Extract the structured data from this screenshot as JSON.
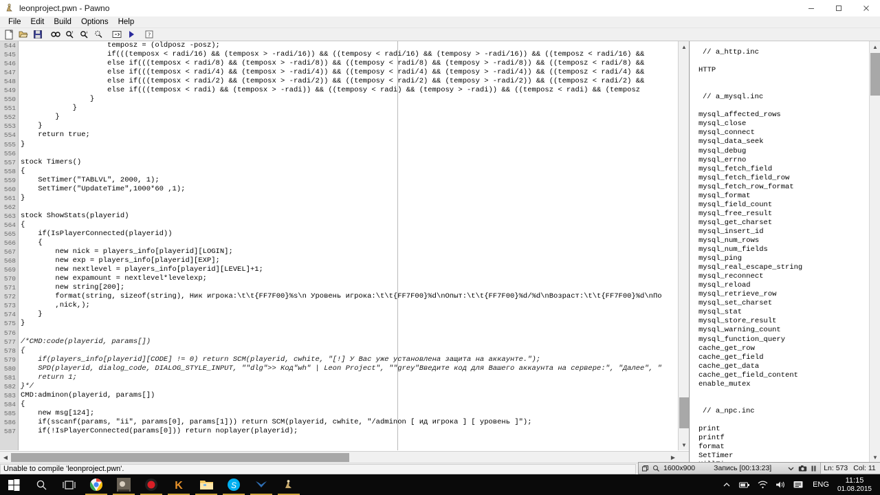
{
  "window": {
    "title": "leonproject.pwn - Pawno",
    "icon": "pawno-icon",
    "minimize": "minimize-icon",
    "maximize": "maximize-icon",
    "close": "close-icon"
  },
  "menubar": {
    "items": [
      "File",
      "Edit",
      "Build",
      "Options",
      "Help"
    ]
  },
  "toolbar": {
    "buttons": [
      {
        "name": "new-file-icon",
        "tip": "New"
      },
      {
        "name": "open-file-icon",
        "tip": "Open"
      },
      {
        "name": "save-file-icon",
        "tip": "Save"
      },
      {
        "name": "find-icon",
        "tip": "Find"
      },
      {
        "name": "find-previous-icon",
        "tip": "Find previous"
      },
      {
        "name": "find-next-icon",
        "tip": "Find next"
      },
      {
        "name": "replace-icon",
        "tip": "Replace"
      },
      {
        "name": "compile-icon",
        "tip": "Compile"
      },
      {
        "name": "run-icon",
        "tip": "Run"
      },
      {
        "name": "help-icon",
        "tip": "Help"
      }
    ]
  },
  "editor": {
    "first_line": 544,
    "lines": [
      {
        "n": 544,
        "text": "                    temposz = (oldposz -posz);",
        "italic": false
      },
      {
        "n": 545,
        "text": "                    if(((temposx < radi/16) && (temposx > -radi/16)) && ((temposy < radi/16) && (temposy > -radi/16)) && ((temposz < radi/16) &&",
        "italic": false
      },
      {
        "n": 546,
        "text": "                    else if(((temposx < radi/8) && (temposx > -radi/8)) && ((temposy < radi/8) && (temposy > -radi/8)) && ((temposz < radi/8) &&",
        "italic": false
      },
      {
        "n": 547,
        "text": "                    else if(((temposx < radi/4) && (temposx > -radi/4)) && ((temposy < radi/4) && (temposy > -radi/4)) && ((temposz < radi/4) &&",
        "italic": false
      },
      {
        "n": 548,
        "text": "                    else if(((temposx < radi/2) && (temposx > -radi/2)) && ((temposy < radi/2) && (temposy > -radi/2)) && ((temposz < radi/2) &&",
        "italic": false
      },
      {
        "n": 549,
        "text": "                    else if(((temposx < radi) && (temposx > -radi)) && ((temposy < radi) && (temposy > -radi)) && ((temposz < radi) && (temposz",
        "italic": false
      },
      {
        "n": 550,
        "text": "                }",
        "italic": false
      },
      {
        "n": 551,
        "text": "            }",
        "italic": false
      },
      {
        "n": 552,
        "text": "        }",
        "italic": false
      },
      {
        "n": 553,
        "text": "    }",
        "italic": false
      },
      {
        "n": 554,
        "text": "    return true;",
        "italic": false
      },
      {
        "n": 555,
        "text": "}",
        "italic": false
      },
      {
        "n": 556,
        "text": "",
        "italic": false
      },
      {
        "n": 557,
        "text": "stock Timers()",
        "italic": false
      },
      {
        "n": 558,
        "text": "{",
        "italic": false
      },
      {
        "n": 559,
        "text": "    SetTimer(\"TABLVL\", 2000, 1);",
        "italic": false
      },
      {
        "n": 560,
        "text": "    SetTimer(\"UpdateTime\",1000*60 ,1);",
        "italic": false
      },
      {
        "n": 561,
        "text": "}",
        "italic": false
      },
      {
        "n": 562,
        "text": "",
        "italic": false
      },
      {
        "n": 563,
        "text": "stock ShowStats(playerid)",
        "italic": false
      },
      {
        "n": 564,
        "text": "{",
        "italic": false
      },
      {
        "n": 565,
        "text": "    if(IsPlayerConnected(playerid))",
        "italic": false
      },
      {
        "n": 566,
        "text": "    {",
        "italic": false
      },
      {
        "n": 567,
        "text": "        new nick = players_info[playerid][LOGIN];",
        "italic": false
      },
      {
        "n": 568,
        "text": "        new exp = players_info[playerid][EXP];",
        "italic": false
      },
      {
        "n": 569,
        "text": "        new nextlevel = players_info[playerid][LEVEL]+1;",
        "italic": false
      },
      {
        "n": 570,
        "text": "        new expamount = nextlevel*levelexp;",
        "italic": false
      },
      {
        "n": 571,
        "text": "        new string[200];",
        "italic": false
      },
      {
        "n": 572,
        "text": "        format(string, sizeof(string), Ник игрока:\\t\\t{FF7F00}%s\\n Уровень игрока:\\t\\t{FF7F00}%d\\nОпыт:\\t\\t{FF7F00}%d/%d\\nВозраст:\\t\\t{FF7F00}%d\\nПо",
        "italic": false
      },
      {
        "n": 573,
        "text": "        ,nick,);",
        "italic": false
      },
      {
        "n": 574,
        "text": "    }",
        "italic": false
      },
      {
        "n": 575,
        "text": "}",
        "italic": false
      },
      {
        "n": 576,
        "text": "",
        "italic": false
      },
      {
        "n": 577,
        "text": "/*CMD:code(playerid, params[])",
        "italic": true
      },
      {
        "n": 578,
        "text": "{",
        "italic": true
      },
      {
        "n": 579,
        "text": "    if(players_info[playerid][CODE] != 0) return SCM(playerid, cwhite, \"[!] У Вас уже установлена защита на аккаунте.\");",
        "italic": true
      },
      {
        "n": 580,
        "text": "    SPD(playerid, dialog_code, DIALOG_STYLE_INPUT, \"\"dlg\">> Код\"wh\" | Leon Project\", \"\"grey\"Введите код для Вашего аккаунта на сервере:\", \"Далее\", \"",
        "italic": true
      },
      {
        "n": 581,
        "text": "    return 1;",
        "italic": true
      },
      {
        "n": 582,
        "text": "}*/",
        "italic": true
      },
      {
        "n": 583,
        "text": "CMD:adminon(playerid, params[])",
        "italic": false
      },
      {
        "n": 584,
        "text": "{",
        "italic": false
      },
      {
        "n": 585,
        "text": "    new msg[124];",
        "italic": false
      },
      {
        "n": 586,
        "text": "    if(sscanf(params, \"ii\", params[0], params[1])) return SCM(playerid, cwhite, \"/adminon [ ид игрока ] [ уровень ]\");",
        "italic": false
      },
      {
        "n": 587,
        "text": "    if(!IsPlayerConnected(params[0])) return noplayer(playerid);",
        "italic": false
      }
    ],
    "scroll_up_icon": "scroll-up-arrow-icon",
    "scroll_down_icon": "scroll-down-arrow-icon",
    "scroll_left_icon": "scroll-left-arrow-icon",
    "scroll_right_icon": "scroll-right-arrow-icon"
  },
  "function_panel": {
    "items": [
      {
        "text": "// a_http.inc",
        "kind": "header"
      },
      {
        "text": "",
        "kind": "blank"
      },
      {
        "text": "HTTP",
        "kind": "fn"
      },
      {
        "text": "",
        "kind": "blank"
      },
      {
        "text": "",
        "kind": "blank"
      },
      {
        "text": "// a_mysql.inc",
        "kind": "header"
      },
      {
        "text": "",
        "kind": "blank"
      },
      {
        "text": "mysql_affected_rows",
        "kind": "fn"
      },
      {
        "text": "mysql_close",
        "kind": "fn"
      },
      {
        "text": "mysql_connect",
        "kind": "fn"
      },
      {
        "text": "mysql_data_seek",
        "kind": "fn"
      },
      {
        "text": "mysql_debug",
        "kind": "fn"
      },
      {
        "text": "mysql_errno",
        "kind": "fn"
      },
      {
        "text": "mysql_fetch_field",
        "kind": "fn"
      },
      {
        "text": "mysql_fetch_field_row",
        "kind": "fn"
      },
      {
        "text": "mysql_fetch_row_format",
        "kind": "fn"
      },
      {
        "text": "mysql_format",
        "kind": "fn"
      },
      {
        "text": "mysql_field_count",
        "kind": "fn"
      },
      {
        "text": "mysql_free_result",
        "kind": "fn"
      },
      {
        "text": "mysql_get_charset",
        "kind": "fn"
      },
      {
        "text": "mysql_insert_id",
        "kind": "fn"
      },
      {
        "text": "mysql_num_rows",
        "kind": "fn"
      },
      {
        "text": "mysql_num_fields",
        "kind": "fn"
      },
      {
        "text": "mysql_ping",
        "kind": "fn"
      },
      {
        "text": "mysql_real_escape_string",
        "kind": "fn"
      },
      {
        "text": "mysql_reconnect",
        "kind": "fn"
      },
      {
        "text": "mysql_reload",
        "kind": "fn"
      },
      {
        "text": "mysql_retrieve_row",
        "kind": "fn"
      },
      {
        "text": "mysql_set_charset",
        "kind": "fn"
      },
      {
        "text": "mysql_stat",
        "kind": "fn"
      },
      {
        "text": "mysql_store_result",
        "kind": "fn"
      },
      {
        "text": "mysql_warning_count",
        "kind": "fn"
      },
      {
        "text": "mysql_function_query",
        "kind": "fn"
      },
      {
        "text": "cache_get_row",
        "kind": "fn"
      },
      {
        "text": "cache_get_field",
        "kind": "fn"
      },
      {
        "text": "cache_get_data",
        "kind": "fn"
      },
      {
        "text": "cache_get_field_content",
        "kind": "fn"
      },
      {
        "text": "enable_mutex",
        "kind": "fn"
      },
      {
        "text": "",
        "kind": "blank"
      },
      {
        "text": "",
        "kind": "blank"
      },
      {
        "text": "// a_npc.inc",
        "kind": "header"
      },
      {
        "text": "",
        "kind": "blank"
      },
      {
        "text": "print",
        "kind": "fn"
      },
      {
        "text": "printf",
        "kind": "fn"
      },
      {
        "text": "format",
        "kind": "fn"
      },
      {
        "text": "SetTimer",
        "kind": "fn"
      },
      {
        "text": "KillTimer",
        "kind": "fn"
      }
    ]
  },
  "statusbar": {
    "message": "Unable to compile 'leonproject.pwn'."
  },
  "recorder": {
    "restore_icon": "restore-window-icon",
    "zoom_icon": "magnifier-icon",
    "resolution": "1600x900",
    "record_label": "Запись [00:13:23]",
    "dropdown_icon": "chevron-down-icon",
    "camera_icon": "camera-icon",
    "pause_icon": "pause-icon",
    "line_label": "Ln: 573",
    "col_label": "Col: 11"
  },
  "taskbar": {
    "start_icon": "windows-start-icon",
    "search_icon": "search-icon",
    "taskview_icon": "task-view-icon",
    "apps": [
      {
        "name": "chrome-icon",
        "active": true
      },
      {
        "name": "gta-sa-icon",
        "active": true
      },
      {
        "name": "bandicam-icon",
        "active": true
      },
      {
        "name": "kaspersky-icon",
        "active": true
      },
      {
        "name": "file-explorer-icon",
        "active": true
      },
      {
        "name": "skype-icon",
        "active": true
      },
      {
        "name": "teamviewer-icon",
        "active": true
      },
      {
        "name": "pawno-icon",
        "active": true
      }
    ],
    "tray": [
      {
        "name": "show-hidden-icons-icon"
      },
      {
        "name": "battery-icon"
      },
      {
        "name": "wifi-icon"
      },
      {
        "name": "volume-icon"
      },
      {
        "name": "action-center-icon"
      }
    ],
    "language": "ENG",
    "time": "11:15",
    "date": "01.08.2015"
  },
  "colors": {
    "taskbar_bg": "#0a0a0a",
    "window_bg": "#f0f0f0",
    "editor_bg": "#ffffff",
    "gutter_bg": "#dadada",
    "accent": "#cfa33b"
  }
}
